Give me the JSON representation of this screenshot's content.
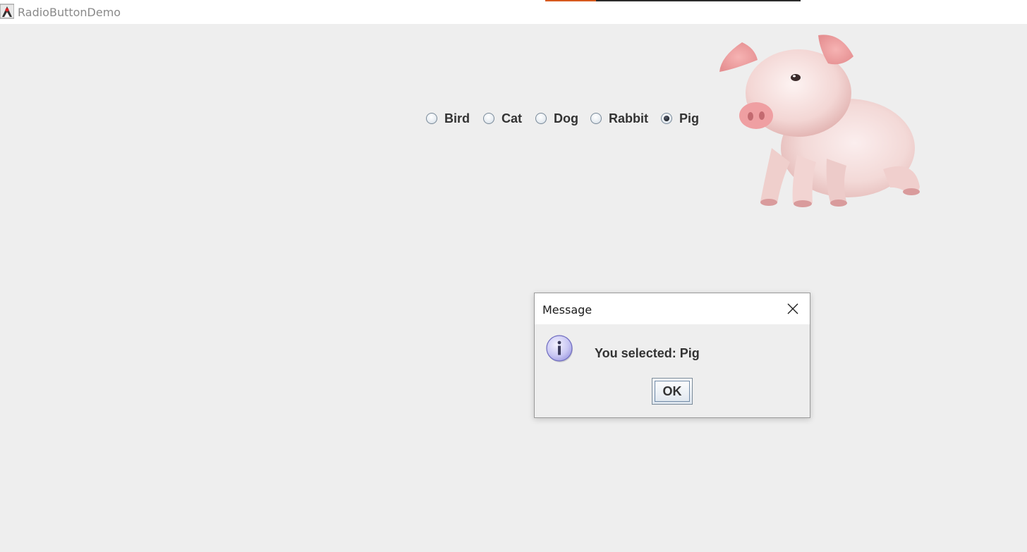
{
  "window": {
    "title": "RadioButtonDemo",
    "icon": "java-duke-icon"
  },
  "radio_group": {
    "options": [
      {
        "label": "Bird",
        "checked": false
      },
      {
        "label": "Cat",
        "checked": false
      },
      {
        "label": "Dog",
        "checked": false
      },
      {
        "label": "Rabbit",
        "checked": false
      },
      {
        "label": "Pig",
        "checked": true
      }
    ],
    "selected": "Pig"
  },
  "image": {
    "name": "pig-image"
  },
  "dialog": {
    "title": "Message",
    "message": "You selected: Pig",
    "ok_label": "OK",
    "icon": "info-icon",
    "close_icon": "close-icon"
  },
  "colors": {
    "background": "#eeeeee",
    "titlebar": "#ffffff",
    "text": "#333333",
    "accent_orange": "#d75a1e"
  }
}
